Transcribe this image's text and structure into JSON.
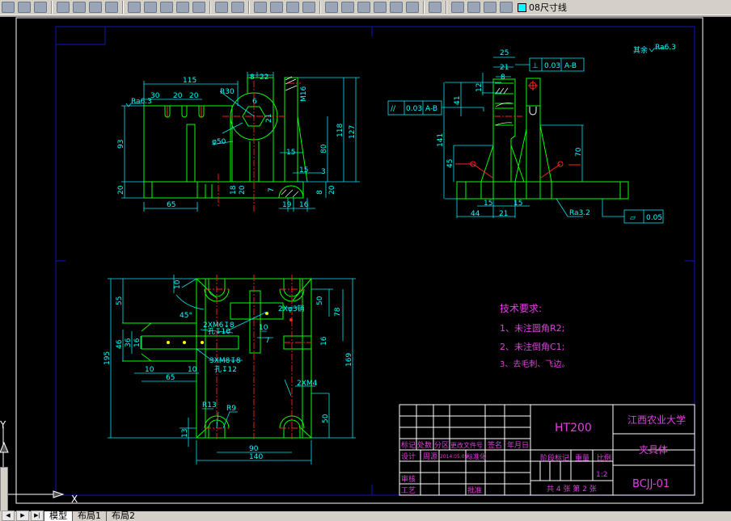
{
  "toolbar": {
    "icons": [
      "new-icon",
      "open-icon",
      "save-icon",
      "print-icon",
      "preview-icon",
      "publish-icon",
      "web-icon",
      "cut-icon",
      "copy-icon",
      "paste-icon",
      "match-properties-icon",
      "block-editor-icon",
      "undo-icon",
      "redo-icon",
      "pan-icon",
      "zoom-realtime-icon",
      "zoom-window-icon",
      "zoom-previous-icon",
      "properties-icon",
      "design-center-icon",
      "tool-palettes-icon",
      "sheet-set-icon",
      "markup-icon",
      "calculator-icon",
      "help-icon",
      "layer-manager-icon",
      "layer-on-icon",
      "layer-freeze-icon",
      "layer-lock-icon"
    ],
    "layer_name": "08尺寸线",
    "layer_color": "#00ffff"
  },
  "tabs": [
    "模型",
    "布局1",
    "布局2"
  ],
  "ucs": {
    "x_label": "X",
    "y_label": "Y"
  },
  "colors": {
    "background": "#000000",
    "geometry": "#00ff00",
    "dimensions": "#00ffff",
    "centerlines": "#ff2020",
    "text": "#e040e0",
    "frame": "#ffffff",
    "limits": "#0000a0"
  },
  "front_view": {
    "dims": [
      "115",
      "30",
      "20",
      "20",
      "8",
      "22",
      "R30",
      "6",
      "21",
      "φ50",
      "M16",
      "118",
      "127",
      "80",
      "15",
      "15",
      "3",
      "93",
      "20",
      "65",
      "18",
      "20",
      "7",
      "20",
      "8",
      "19",
      "16"
    ],
    "roughness": "Ra6.3"
  },
  "side_view": {
    "dims": [
      "25",
      "21",
      "8",
      "12",
      "41",
      "141",
      "45",
      "70",
      "15",
      "15",
      "44",
      "21"
    ],
    "note": "其余",
    "roughness_note": "Ra6.3",
    "roughness_base": "Ra3.2",
    "tolerance_top": {
      "symbol": "⊥",
      "value": "0.03",
      "datum": "A-B"
    },
    "tolerance_left": {
      "symbol": "//",
      "value": "0.03",
      "datum": "A-B"
    },
    "tolerance_bottom": {
      "symbol": "▱",
      "value": "0.05"
    }
  },
  "plan_view": {
    "dims": [
      "10",
      "55",
      "45°",
      "50",
      "78",
      "16",
      "169",
      "195",
      "46",
      "36",
      "16",
      "10",
      "10",
      "65",
      "10",
      "7",
      "50",
      "R13",
      "R9",
      "13",
      "90",
      "140"
    ],
    "callouts": {
      "m6": "2XM6↧8",
      "m6_hole": "孔↧10",
      "pin": "2Xφ3销",
      "m8": "3XM8↧8",
      "m8_hole": "孔↧12",
      "m4": "2XM4"
    }
  },
  "tech_requirements": {
    "title": "技术要求:",
    "items": [
      "1、未注圆角R2;",
      "2、未注倒角C1;",
      "3、去毛刺、飞边。"
    ]
  },
  "title_block": {
    "headers": [
      "标记",
      "处数",
      "分区",
      "更改文件号",
      "签名",
      "年月日"
    ],
    "design_label": "设计",
    "designer": "周源",
    "date": "2014.05.05",
    "standard_label": "标准化",
    "review_label": "审核",
    "process_label": "工艺",
    "approve_label": "批准",
    "material": "HT200",
    "stage_label": "阶段标记",
    "weight_label": "重量",
    "scale_label": "比例",
    "scale": "1:2",
    "sheet": "共 4 张 第 2 张",
    "school": "江西农业大学",
    "part_name": "夹具体",
    "drawing_number": "BCJJ-01"
  }
}
